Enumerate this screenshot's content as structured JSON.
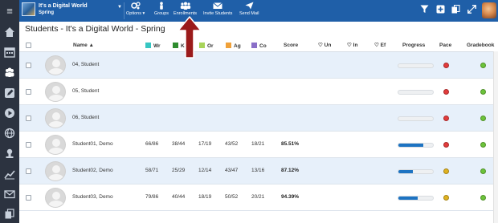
{
  "topbar": {
    "course_title": "It's a Digital World",
    "course_term": "Spring",
    "options_label": "Options",
    "groups_label": "Groups",
    "enrollments_label": "Enrollments",
    "invite_label": "Invite Students",
    "send_mail_label": "Send Mail"
  },
  "page": {
    "title": "Students - It's a Digital World - Spring"
  },
  "columns": {
    "name": "Name",
    "wr": "Wr",
    "k": "K",
    "or": "Or",
    "ag": "Ag",
    "co": "Co",
    "score": "Score",
    "un": "Un",
    "in": "In",
    "ef": "Ef",
    "progress": "Progress",
    "pace": "Pace",
    "gradebook": "Gradebook"
  },
  "colors": {
    "topbar": "#1f5fa8",
    "sidebar": "#2c3340",
    "row_alt": "#e7f0fa",
    "wr": "#37c6c2",
    "k": "#2f8c2f",
    "or": "#a8d45a",
    "ag": "#f0a13a",
    "co": "#8a6fc8",
    "progress_fill": "#1d73c2",
    "pace_red": "#e23b3b",
    "pace_yellow": "#e0b21f",
    "gradebook_green": "#6cc33a",
    "arrow": "#9b1b1b"
  },
  "rows": [
    {
      "name": "04, Student",
      "wr": "",
      "k": "",
      "or": "",
      "ag": "",
      "co": "",
      "score": "",
      "progress": 0,
      "pace": "red",
      "gradebook": "green"
    },
    {
      "name": "05, Student",
      "wr": "",
      "k": "",
      "or": "",
      "ag": "",
      "co": "",
      "score": "",
      "progress": 0,
      "pace": "red",
      "gradebook": "green"
    },
    {
      "name": "06, Student",
      "wr": "",
      "k": "",
      "or": "",
      "ag": "",
      "co": "",
      "score": "",
      "progress": 0,
      "pace": "red",
      "gradebook": "green"
    },
    {
      "name": "Student01, Demo",
      "wr": "66/86",
      "k": "38/44",
      "or": "17/19",
      "ag": "43/52",
      "co": "18/21",
      "score": "85.51%",
      "progress": 0.72,
      "pace": "red",
      "gradebook": "green"
    },
    {
      "name": "Student02, Demo",
      "wr": "58/71",
      "k": "25/29",
      "or": "12/14",
      "ag": "43/47",
      "co": "13/16",
      "score": "87.12%",
      "progress": 0.42,
      "pace": "yellow",
      "gradebook": "green"
    },
    {
      "name": "Student03, Demo",
      "wr": "79/86",
      "k": "40/44",
      "or": "18/19",
      "ag": "50/52",
      "co": "20/21",
      "score": "94.39%",
      "progress": 0.55,
      "pace": "yellow",
      "gradebook": "green"
    }
  ],
  "icons": {
    "menu": "hamburger-icon",
    "sidebar": [
      "home-icon",
      "calendar-icon",
      "users-icon",
      "edit-icon",
      "play-icon",
      "globe-icon",
      "award-icon",
      "chart-icon",
      "mail-icon",
      "copy-icon"
    ]
  }
}
